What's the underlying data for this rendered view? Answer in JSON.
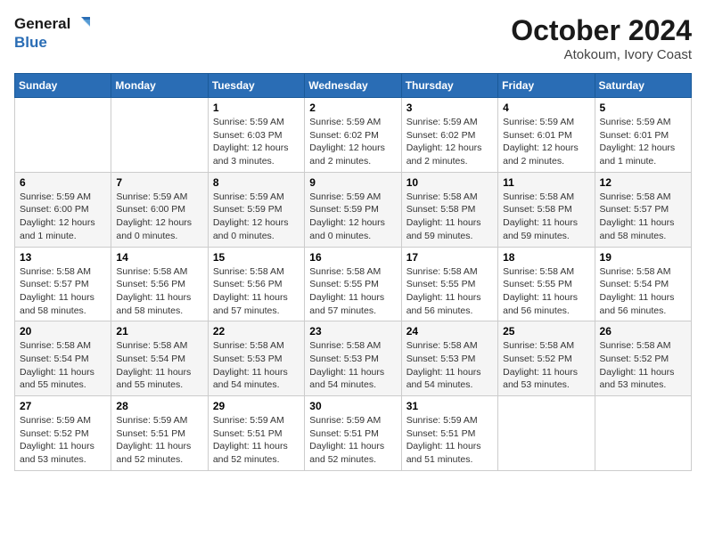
{
  "header": {
    "logo_line1": "General",
    "logo_line2": "Blue",
    "month_title": "October 2024",
    "location": "Atokoum, Ivory Coast"
  },
  "weekdays": [
    "Sunday",
    "Monday",
    "Tuesday",
    "Wednesday",
    "Thursday",
    "Friday",
    "Saturday"
  ],
  "weeks": [
    [
      {
        "day": "",
        "info": ""
      },
      {
        "day": "",
        "info": ""
      },
      {
        "day": "1",
        "info": "Sunrise: 5:59 AM\nSunset: 6:03 PM\nDaylight: 12 hours and 3 minutes."
      },
      {
        "day": "2",
        "info": "Sunrise: 5:59 AM\nSunset: 6:02 PM\nDaylight: 12 hours and 2 minutes."
      },
      {
        "day": "3",
        "info": "Sunrise: 5:59 AM\nSunset: 6:02 PM\nDaylight: 12 hours and 2 minutes."
      },
      {
        "day": "4",
        "info": "Sunrise: 5:59 AM\nSunset: 6:01 PM\nDaylight: 12 hours and 2 minutes."
      },
      {
        "day": "5",
        "info": "Sunrise: 5:59 AM\nSunset: 6:01 PM\nDaylight: 12 hours and 1 minute."
      }
    ],
    [
      {
        "day": "6",
        "info": "Sunrise: 5:59 AM\nSunset: 6:00 PM\nDaylight: 12 hours and 1 minute."
      },
      {
        "day": "7",
        "info": "Sunrise: 5:59 AM\nSunset: 6:00 PM\nDaylight: 12 hours and 0 minutes."
      },
      {
        "day": "8",
        "info": "Sunrise: 5:59 AM\nSunset: 5:59 PM\nDaylight: 12 hours and 0 minutes."
      },
      {
        "day": "9",
        "info": "Sunrise: 5:59 AM\nSunset: 5:59 PM\nDaylight: 12 hours and 0 minutes."
      },
      {
        "day": "10",
        "info": "Sunrise: 5:58 AM\nSunset: 5:58 PM\nDaylight: 11 hours and 59 minutes."
      },
      {
        "day": "11",
        "info": "Sunrise: 5:58 AM\nSunset: 5:58 PM\nDaylight: 11 hours and 59 minutes."
      },
      {
        "day": "12",
        "info": "Sunrise: 5:58 AM\nSunset: 5:57 PM\nDaylight: 11 hours and 58 minutes."
      }
    ],
    [
      {
        "day": "13",
        "info": "Sunrise: 5:58 AM\nSunset: 5:57 PM\nDaylight: 11 hours and 58 minutes."
      },
      {
        "day": "14",
        "info": "Sunrise: 5:58 AM\nSunset: 5:56 PM\nDaylight: 11 hours and 58 minutes."
      },
      {
        "day": "15",
        "info": "Sunrise: 5:58 AM\nSunset: 5:56 PM\nDaylight: 11 hours and 57 minutes."
      },
      {
        "day": "16",
        "info": "Sunrise: 5:58 AM\nSunset: 5:55 PM\nDaylight: 11 hours and 57 minutes."
      },
      {
        "day": "17",
        "info": "Sunrise: 5:58 AM\nSunset: 5:55 PM\nDaylight: 11 hours and 56 minutes."
      },
      {
        "day": "18",
        "info": "Sunrise: 5:58 AM\nSunset: 5:55 PM\nDaylight: 11 hours and 56 minutes."
      },
      {
        "day": "19",
        "info": "Sunrise: 5:58 AM\nSunset: 5:54 PM\nDaylight: 11 hours and 56 minutes."
      }
    ],
    [
      {
        "day": "20",
        "info": "Sunrise: 5:58 AM\nSunset: 5:54 PM\nDaylight: 11 hours and 55 minutes."
      },
      {
        "day": "21",
        "info": "Sunrise: 5:58 AM\nSunset: 5:54 PM\nDaylight: 11 hours and 55 minutes."
      },
      {
        "day": "22",
        "info": "Sunrise: 5:58 AM\nSunset: 5:53 PM\nDaylight: 11 hours and 54 minutes."
      },
      {
        "day": "23",
        "info": "Sunrise: 5:58 AM\nSunset: 5:53 PM\nDaylight: 11 hours and 54 minutes."
      },
      {
        "day": "24",
        "info": "Sunrise: 5:58 AM\nSunset: 5:53 PM\nDaylight: 11 hours and 54 minutes."
      },
      {
        "day": "25",
        "info": "Sunrise: 5:58 AM\nSunset: 5:52 PM\nDaylight: 11 hours and 53 minutes."
      },
      {
        "day": "26",
        "info": "Sunrise: 5:58 AM\nSunset: 5:52 PM\nDaylight: 11 hours and 53 minutes."
      }
    ],
    [
      {
        "day": "27",
        "info": "Sunrise: 5:59 AM\nSunset: 5:52 PM\nDaylight: 11 hours and 53 minutes."
      },
      {
        "day": "28",
        "info": "Sunrise: 5:59 AM\nSunset: 5:51 PM\nDaylight: 11 hours and 52 minutes."
      },
      {
        "day": "29",
        "info": "Sunrise: 5:59 AM\nSunset: 5:51 PM\nDaylight: 11 hours and 52 minutes."
      },
      {
        "day": "30",
        "info": "Sunrise: 5:59 AM\nSunset: 5:51 PM\nDaylight: 11 hours and 52 minutes."
      },
      {
        "day": "31",
        "info": "Sunrise: 5:59 AM\nSunset: 5:51 PM\nDaylight: 11 hours and 51 minutes."
      },
      {
        "day": "",
        "info": ""
      },
      {
        "day": "",
        "info": ""
      }
    ]
  ]
}
